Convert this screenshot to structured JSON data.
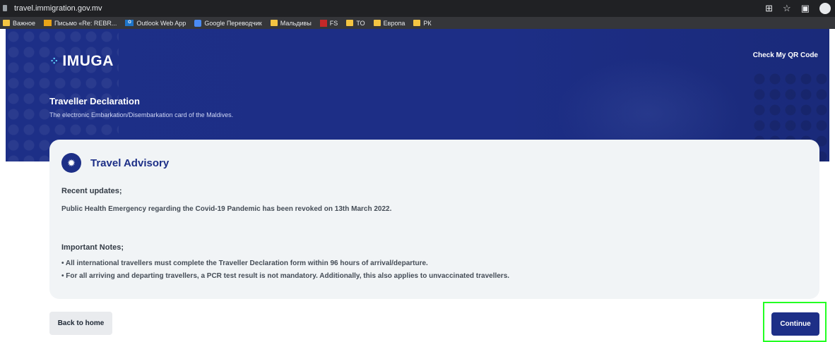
{
  "browser": {
    "url": "travel.immigration.gov.mv",
    "bookmarks": [
      {
        "label": "Важное",
        "icon": "folder-icon"
      },
      {
        "label": "Письмо «Re: REBR...",
        "icon": "mail-icon"
      },
      {
        "label": "Outlook Web App",
        "icon": "outlook-icon"
      },
      {
        "label": "Google Переводчик",
        "icon": "google-translate-icon"
      },
      {
        "label": "Мальдивы",
        "icon": "folder-icon"
      },
      {
        "label": "FS",
        "icon": "fs-icon"
      },
      {
        "label": "TO",
        "icon": "folder-icon"
      },
      {
        "label": "Европа",
        "icon": "folder-icon"
      },
      {
        "label": "РК",
        "icon": "folder-icon"
      }
    ]
  },
  "header": {
    "logo_text": "IMUGA",
    "qr_link": "Check My QR Code",
    "title": "Traveller Declaration",
    "subtitle": "The electronic Embarkation/Disembarkation card of the Maldives."
  },
  "advisory": {
    "title": "Travel Advisory",
    "recent_heading": "Recent updates;",
    "recent_text": "Public Health Emergency regarding the Covid-19 Pandemic has been revoked on 13th March 2022.",
    "notes_heading": "Important Notes;",
    "notes": [
      "• All international travellers must complete the Traveller Declaration form within 96 hours of arrival/departure.",
      "• For all arriving and departing travellers, a PCR test result is not mandatory. Additionally, this also applies to unvaccinated travellers."
    ]
  },
  "actions": {
    "back_label": "Back to home",
    "continue_label": "Continue"
  },
  "colors": {
    "brand_navy": "#1d2f87",
    "highlight": "#22ff22"
  }
}
